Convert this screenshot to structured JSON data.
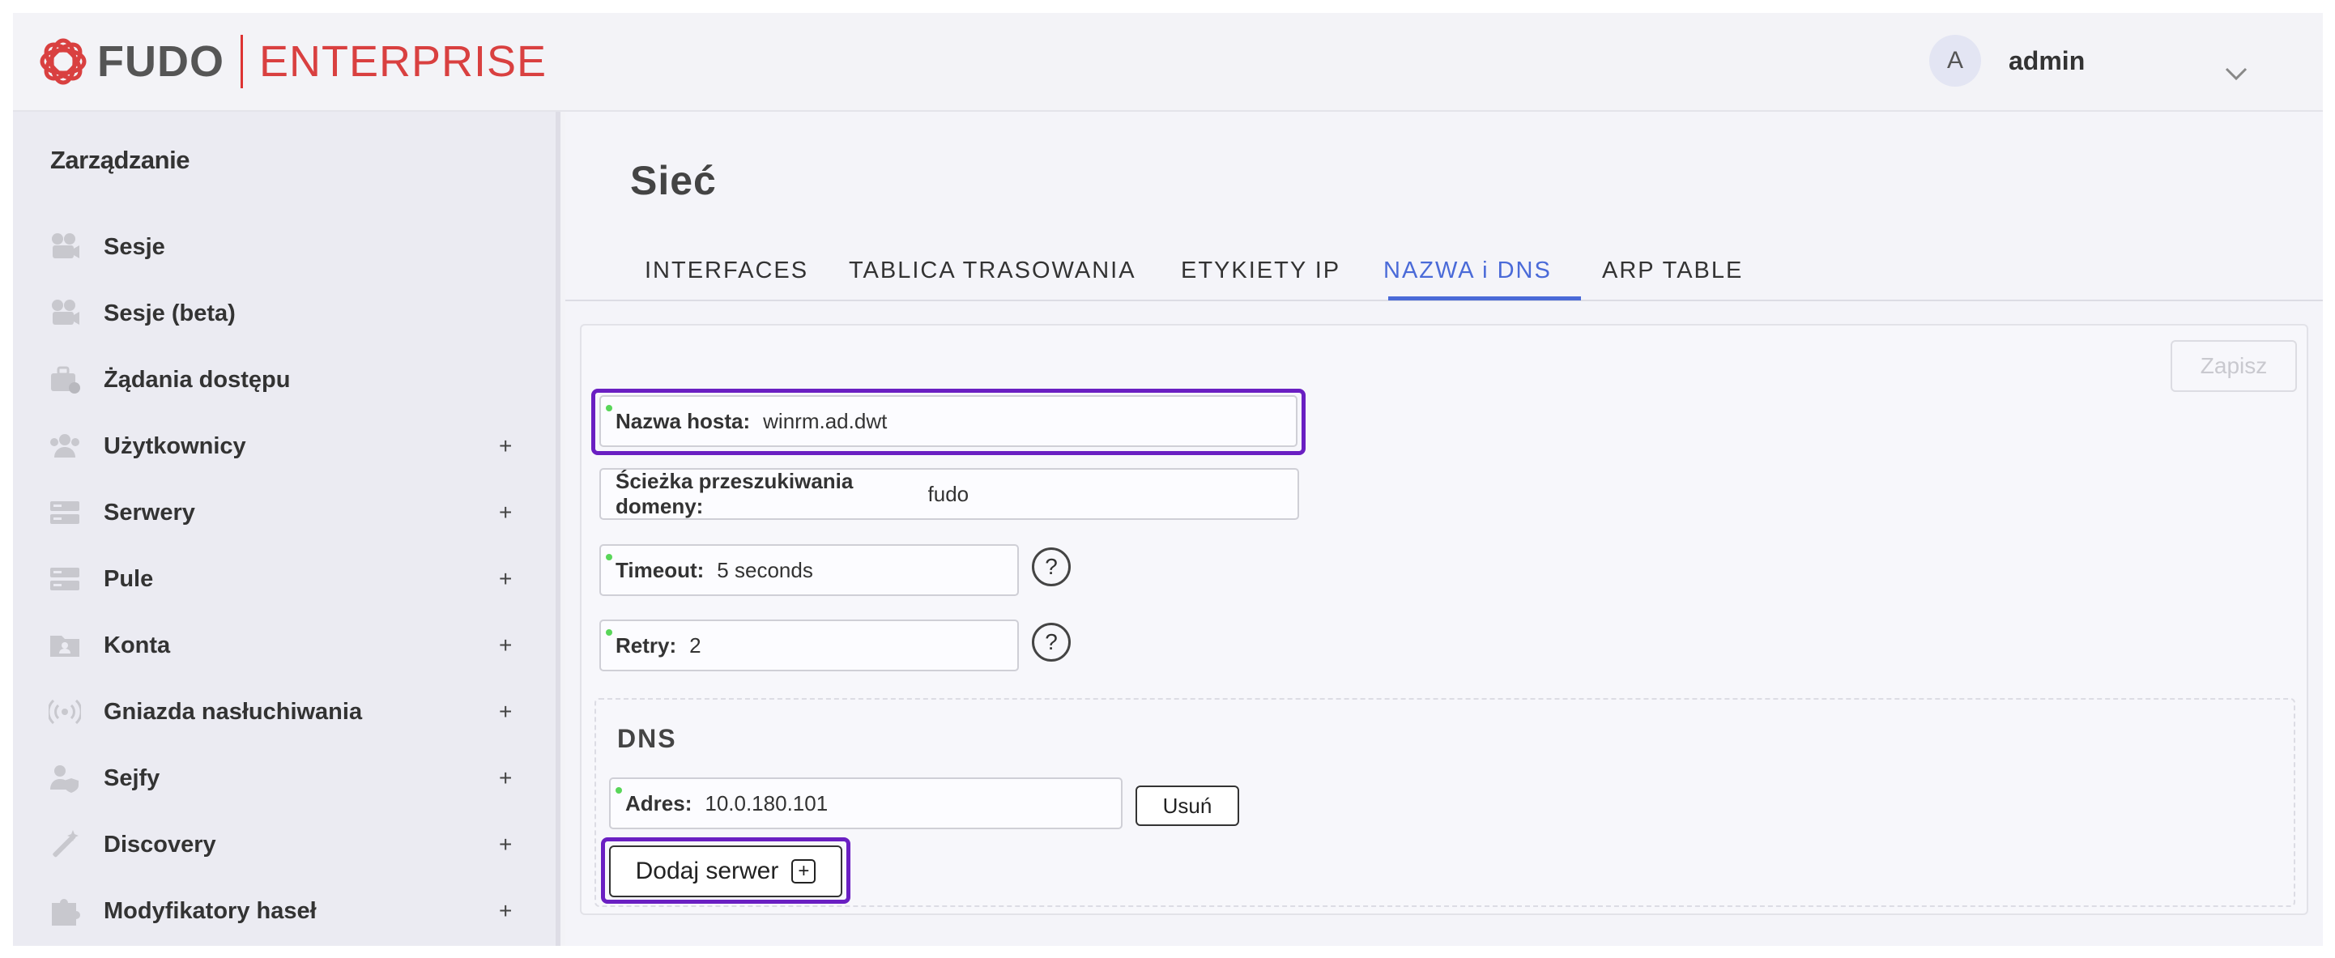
{
  "brand": {
    "name": "FUDO",
    "edition": "ENTERPRISE",
    "colors": {
      "red": "#d94040",
      "accent": "#4a6ad8",
      "highlight": "#6a1fc2"
    }
  },
  "user": {
    "initial": "A",
    "name": "admin"
  },
  "sidebar": {
    "title": "Zarządzanie",
    "items": [
      {
        "label": "Sesje",
        "icon": "camera-icon",
        "expandable": false
      },
      {
        "label": "Sesje (beta)",
        "icon": "camera-icon",
        "expandable": false
      },
      {
        "label": "Żądania dostępu",
        "icon": "briefcase-icon",
        "expandable": false
      },
      {
        "label": "Użytkownicy",
        "icon": "users-icon",
        "expandable": true,
        "plus": "+"
      },
      {
        "label": "Serwery",
        "icon": "server-icon",
        "expandable": true,
        "plus": "+"
      },
      {
        "label": "Pule",
        "icon": "server-pool-icon",
        "expandable": true,
        "plus": "+"
      },
      {
        "label": "Konta",
        "icon": "account-folder-icon",
        "expandable": true,
        "plus": "+"
      },
      {
        "label": "Gniazda nasłuchiwania",
        "icon": "broadcast-icon",
        "expandable": true,
        "plus": "+"
      },
      {
        "label": "Sejfy",
        "icon": "user-shield-icon",
        "expandable": true,
        "plus": "+"
      },
      {
        "label": "Discovery",
        "icon": "magic-wand-icon",
        "expandable": true,
        "plus": "+"
      },
      {
        "label": "Modyfikatory haseł",
        "icon": "puzzle-icon",
        "expandable": true,
        "plus": "+"
      }
    ]
  },
  "main": {
    "title": "Sieć",
    "tabs": [
      {
        "label": "INTERFACES",
        "active": false
      },
      {
        "label": "TABLICA TRASOWANIA",
        "active": false
      },
      {
        "label": "ETYKIETY IP",
        "active": false
      },
      {
        "label": "NAZWA i DNS",
        "active": true
      },
      {
        "label": "ARP TABLE",
        "active": false
      }
    ],
    "save_label": "Zapisz",
    "fields": {
      "hostname": {
        "label": "Nazwa hosta:",
        "value": "winrm.ad.dwt"
      },
      "search_domain": {
        "label": "Ścieżka przeszukiwania domeny:",
        "value": "fudo"
      },
      "timeout": {
        "label": "Timeout:",
        "value": "5 seconds",
        "help": "?"
      },
      "retry": {
        "label": "Retry:",
        "value": "2",
        "help": "?"
      }
    },
    "dns": {
      "title": "DNS",
      "address": {
        "label": "Adres:",
        "value": "10.0.180.101"
      },
      "remove_label": "Usuń",
      "add_label": "Dodaj serwer",
      "add_icon": "plus-square-icon"
    }
  }
}
